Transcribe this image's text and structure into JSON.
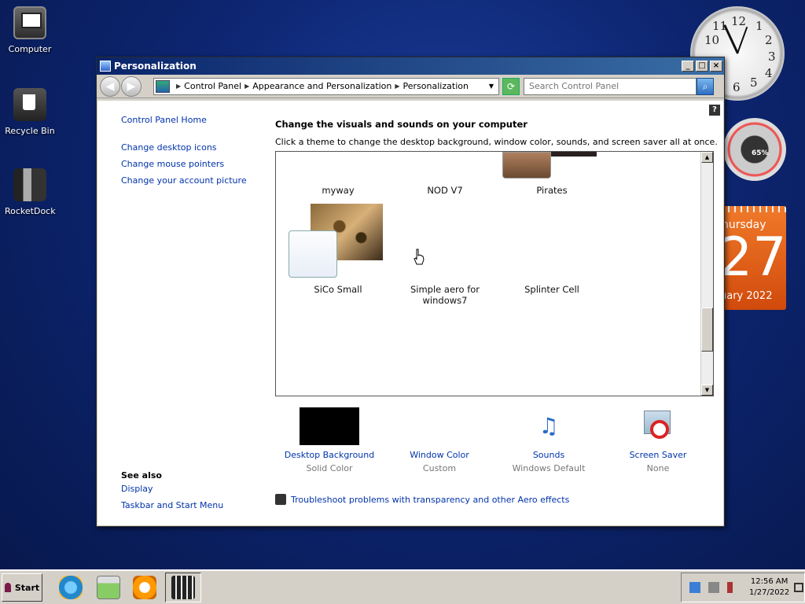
{
  "desktop": {
    "icons": [
      {
        "label": "Computer"
      },
      {
        "label": "Recycle Bin"
      },
      {
        "label": "RocketDock"
      }
    ]
  },
  "gadgets": {
    "clock_numbers": [
      "10",
      "11",
      "12",
      "1",
      "2",
      "3",
      "4",
      "5",
      "6",
      "9"
    ],
    "meter_value": "65%",
    "calendar": {
      "day_partial": "hursday",
      "date_partial": "27",
      "month_partial": "uary 2022"
    }
  },
  "window": {
    "title": "Personalization",
    "address": {
      "crumbs": [
        "Control Panel",
        "Appearance and Personalization",
        "Personalization"
      ]
    },
    "search_placeholder": "Search Control Panel",
    "sidebar": {
      "links": [
        "Control Panel Home",
        "Change desktop icons",
        "Change mouse pointers",
        "Change your account picture"
      ],
      "see_also_title": "See also",
      "see_also_links": [
        "Display",
        "Taskbar and Start Menu"
      ]
    },
    "main": {
      "heading": "Change the visuals and sounds on your computer",
      "subheading": "Click a theme to change the desktop background, window color, sounds, and screen saver all at once.",
      "themes_row1": [
        "myway",
        "NOD V7",
        "Pirates"
      ],
      "themes_row2": [
        "SiCo Small",
        "Simple aero for windows7",
        "Splinter Cell"
      ],
      "options": [
        {
          "label": "Desktop Background",
          "value": "Solid Color",
          "icon": "black-square"
        },
        {
          "label": "Window Color",
          "value": "Custom",
          "icon": "none"
        },
        {
          "label": "Sounds",
          "value": "Windows Default",
          "icon": "music-notes-icon"
        },
        {
          "label": "Screen Saver",
          "value": "None",
          "icon": "no-screensaver-icon"
        }
      ],
      "troubleshoot": "Troubleshoot problems with transparency and other Aero effects"
    }
  },
  "taskbar": {
    "start_label": "Start",
    "time": "12:56 AM",
    "date": "1/27/2022"
  },
  "colors": {
    "link": "#0033aa",
    "titlebar": "#0a246a",
    "calendar": "#e85a18"
  }
}
